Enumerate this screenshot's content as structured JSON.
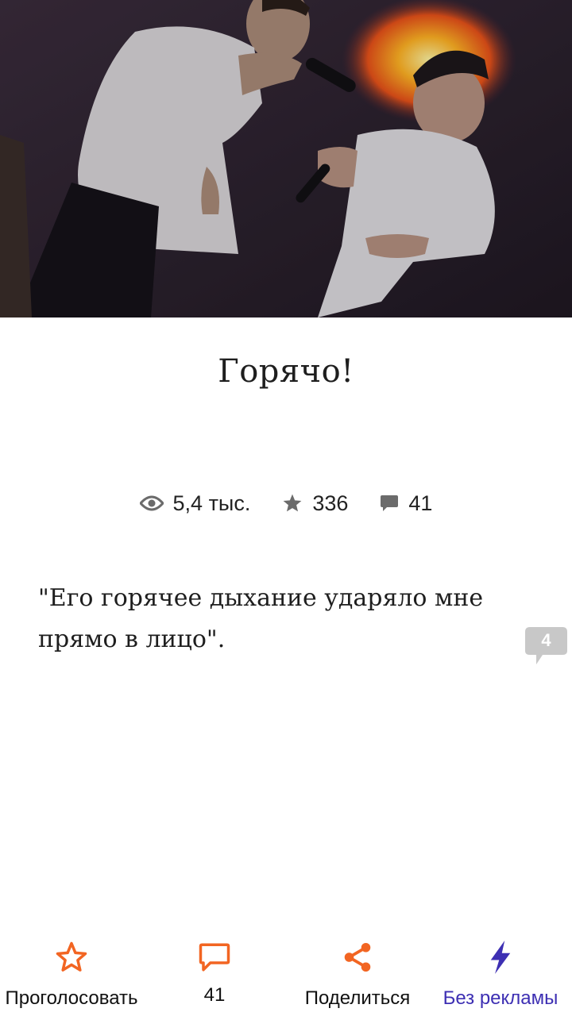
{
  "story": {
    "title": "Горячо!",
    "stats": {
      "views": "5,4 тыс.",
      "votes": "336",
      "comments": "41"
    },
    "paragraph": "\"Его горячее дыхание ударяло мне прямо в лицо\".",
    "paragraph_comment_count": "4"
  },
  "icons": {
    "views": "eye-icon",
    "votes": "star-icon",
    "comments": "comment-icon",
    "vote_action": "star-outline-icon",
    "comments_action": "comment-outline-icon",
    "share_action": "share-icon",
    "no_ads_action": "lightning-icon"
  },
  "bottom_bar": {
    "vote_label": "Проголосовать",
    "comments_label": "41",
    "share_label": "Поделиться",
    "no_ads_label": "Без рекламы"
  },
  "colors": {
    "accent": "#f26522",
    "no_ads": "#3d2fb3",
    "stat_icon": "#6b6b6b",
    "badge": "#c8c8c8"
  }
}
